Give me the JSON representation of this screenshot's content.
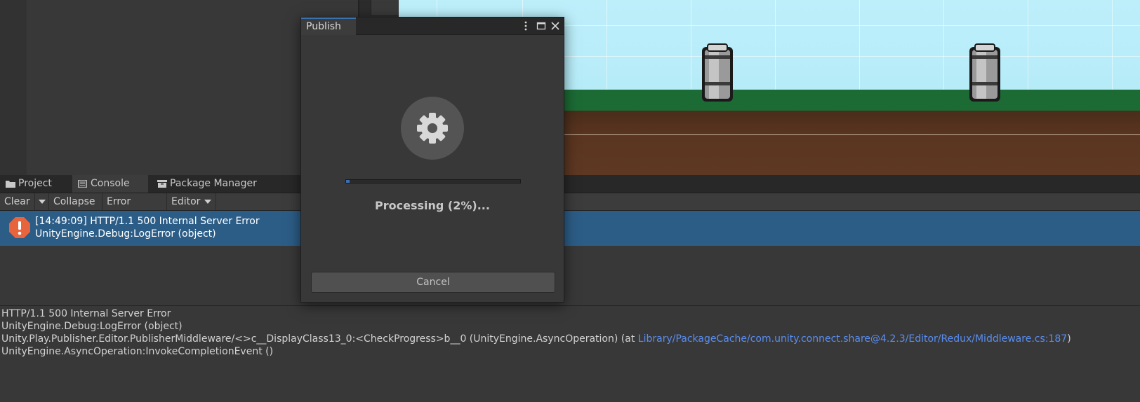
{
  "tabs": [
    {
      "label": "Project",
      "icon": "folder-icon",
      "active": false
    },
    {
      "label": "Console",
      "icon": "console-icon",
      "active": true
    },
    {
      "label": "Package Manager",
      "icon": "package-icon",
      "active": false
    }
  ],
  "console_toolbar": {
    "clear": "Clear",
    "collapse": "Collapse",
    "error_pause": "Error Pause",
    "editor": "Editor"
  },
  "log_entry": {
    "line1": "[14:49:09] HTTP/1.1 500 Internal Server Error",
    "line2": "UnityEngine.Debug:LogError (object)",
    "icon": "error-icon",
    "selected": true
  },
  "detail": {
    "line1": "HTTP/1.1 500 Internal Server Error",
    "line2": "UnityEngine.Debug:LogError (object)",
    "line3_text": "Unity.Play.Publisher.Editor.PublisherMiddleware/<>c__DisplayClass13_0:<CheckProgress>b__0 (UnityEngine.AsyncOperation) (at ",
    "line3_link": "Library/PackageCache/com.unity.connect.share@4.2.3/Editor/Redux/Middleware.cs:187",
    "line3_end": ")",
    "line4": "UnityEngine.AsyncOperation:InvokeCompletionEvent ()"
  },
  "dialog": {
    "title": "Publish",
    "status": "Processing (2%)...",
    "progress": 0.02,
    "cancel_label": "Cancel",
    "icon": "gear-icon"
  },
  "colors": {
    "accent": "#3a72b0",
    "selection": "#2c5d87",
    "link": "#5a8ef0",
    "error": "#e8643c"
  }
}
